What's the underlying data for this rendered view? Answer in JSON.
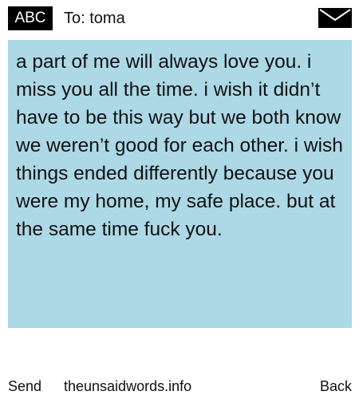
{
  "header": {
    "mode": "ABC",
    "recipient": "To: toma",
    "icon": "envelope-icon"
  },
  "message": {
    "text": "a part of me will always love you. i miss you all the time. i wish it didn’t have to be this way but we both know we weren’t good for each other. i wish things ended differently because you were my home, my safe place. but at the same time fuck you."
  },
  "footer": {
    "send_label": "Send",
    "site": "theunsaidwords.info",
    "back_label": "Back"
  },
  "colors": {
    "message_background": "#add8e6",
    "badge_background": "#000000",
    "text": "#111111"
  }
}
